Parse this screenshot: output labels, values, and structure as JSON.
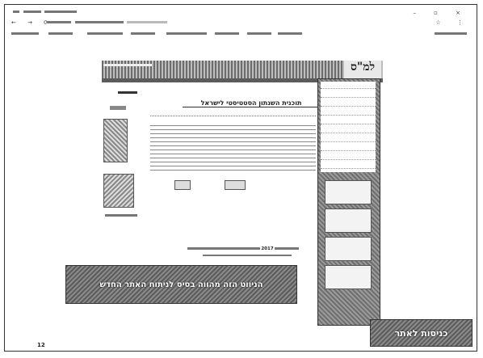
{
  "slide": {
    "page_number": "12",
    "banner_text": "הניווט הזה מהווה בסיס לניתוח האתר החדש",
    "enter_button_label": "כניסות לאתר"
  },
  "browser": {
    "window_controls": "– ▫ ×",
    "nav_icons": "← → ⟳",
    "right_icons": "☆ ⋮"
  },
  "site": {
    "logo_text": "למ\"ס",
    "title": "תוכנית השנתון הסטטיסטי לישראל",
    "footer_year": "2017"
  },
  "sidebar": {
    "box_labels": [
      "",
      "",
      "",
      ""
    ]
  }
}
